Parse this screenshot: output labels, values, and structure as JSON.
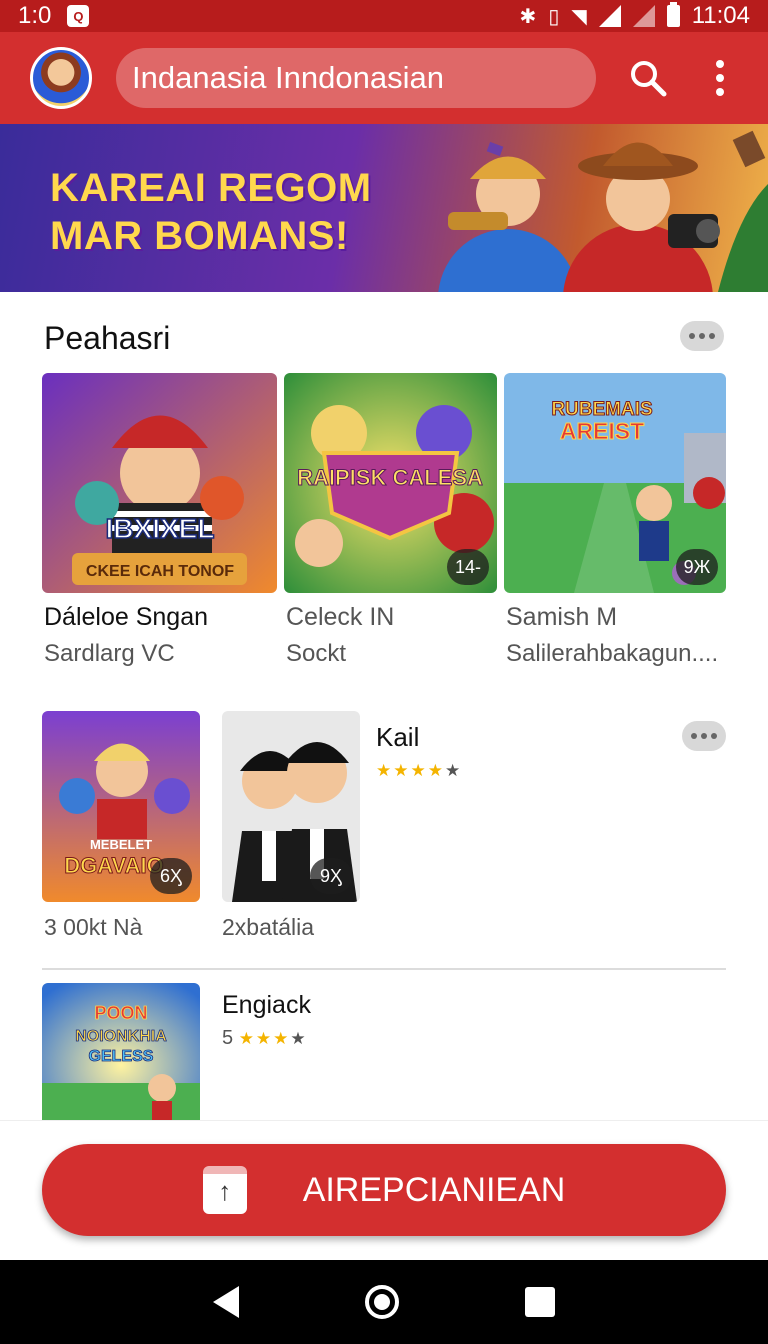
{
  "status_bar": {
    "left_time": "1:0",
    "notif_glyph": "Q",
    "time": "11:04",
    "icons": [
      "bluetooth-icon",
      "vibrate-icon",
      "wifi-icon",
      "signal-icon",
      "signal-icon",
      "battery-icon"
    ]
  },
  "app_bar": {
    "search_text": "Indanasia  Inndonasian",
    "icons": [
      "avatar",
      "search-icon",
      "more-vert-icon"
    ]
  },
  "banner": {
    "line1": "KAREAI REGOM",
    "line2": "MAR BOMANS!"
  },
  "section": {
    "title": "Peahasri"
  },
  "tiles": [
    {
      "title": "Dáleloe Sngan",
      "sub": "Sardlarg VC",
      "art_text_top": "IBXIXEL",
      "art_text_bottom": "CKEE ICAH TONOF"
    },
    {
      "title": "Celeck IN",
      "sub": "Sockt",
      "badge": "14-",
      "art_text": "RAIPISK CALESA"
    },
    {
      "title": "Samish M",
      "sub": "Salilerahbakagun....",
      "badge": "9Ж",
      "art_text_top": "RUBEMAIS",
      "art_text_bottom": "AREIST"
    }
  ],
  "row2": [
    {
      "sub": "3 00kt Nà",
      "badge": "6Ӽ",
      "art_text_top": "MEBELET",
      "art_text_bottom": "DGAVAIO"
    },
    {
      "sub": "2xbatália",
      "badge": "9Ӽ"
    }
  ],
  "list_item_1": {
    "title": "Kail",
    "stars_on": "★★★★",
    "stars_off": "★"
  },
  "list_item_2": {
    "title": "Engiack",
    "rating_prefix": "5",
    "stars_on": "★★★",
    "stars_off": "★",
    "art_text_top": "POON",
    "art_text_mid": "NOIONKHIA",
    "art_text_bottom": "GELESS"
  },
  "action": {
    "label": "AIREPCIANIEAN"
  },
  "colors": {
    "primary": "#d32f2f",
    "status": "#b71c1c",
    "banner_text": "#ffd84d"
  }
}
